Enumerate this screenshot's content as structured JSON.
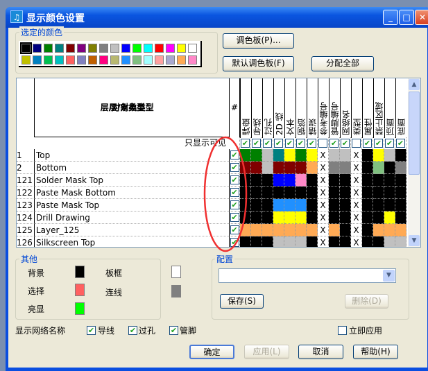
{
  "window": {
    "title": "显示颜色设置",
    "minimize": "_",
    "maximize": "□",
    "close": "✕"
  },
  "palette": {
    "label": "选定的颜色",
    "colors": [
      "#000000",
      "#000080",
      "#008000",
      "#008080",
      "#800000",
      "#800080",
      "#808000",
      "#808080",
      "#c0c0c0",
      "#0000ff",
      "#00ff00",
      "#00ffff",
      "#ff0000",
      "#ff00ff",
      "#ffff00",
      "#ffffff",
      "#c0c000",
      "#0080c0",
      "#00c050",
      "#00c0c0",
      "#ff6060",
      "#8080c0",
      "#c06000",
      "#ff0080",
      "#b8b870",
      "#2090ff",
      "#80c080",
      "#a0ffff",
      "#ffa0a0",
      "#a8a8d0",
      "#ffaa55",
      "#ff88c8"
    ],
    "selected": 0
  },
  "buttons": {
    "palette": "调色板(P)...",
    "default_palette": "默认调色板(F)",
    "assign_all": "分配全部",
    "save": "保存(S)",
    "delete": "删除(D)",
    "ok": "确定",
    "apply": "应用(L)",
    "cancel": "取消",
    "help": "帮助(H)"
  },
  "table": {
    "type_header": "层/对象类型",
    "hash_header": "#",
    "visible_only": "只显示可见",
    "columns": [
      "焊盘",
      "导线",
      "过孔",
      "2D 线",
      "文本",
      "铜箔",
      "错误",
      "参考编号",
      "管脚编号",
      "网络名",
      "类型",
      "属性",
      "禁止区域",
      "顶面",
      "底面"
    ],
    "column_checked": [
      true,
      true,
      true,
      true,
      true,
      true,
      true,
      false,
      true,
      true,
      false,
      true,
      true,
      true,
      true
    ],
    "rows": [
      {
        "num": "1",
        "name": "Top",
        "colors": [
          "#008000",
          "#008000",
          "#c0c0c0",
          "#008080",
          "#ffff00",
          "#008000",
          "#ffff00",
          "X",
          "#c0c0c0",
          "#c0c0c0",
          "X",
          "#000000",
          "#ffff00",
          "#c0c0c0",
          "#000000"
        ]
      },
      {
        "num": "2",
        "name": "Bottom",
        "colors": [
          "#800000",
          "#800000",
          "#c0c0c0",
          "#800000",
          "#800000",
          "#800000",
          "#ffaa55",
          "X",
          "#808080",
          "#808080",
          "X",
          "#000000",
          "#80c080",
          "#000000",
          "#808080"
        ]
      },
      {
        "num": "121",
        "name": "Solder Mask Top",
        "colors": [
          "#000000",
          "#000000",
          "#000000",
          "#0000ff",
          "#0000ff",
          "#ff88c8",
          "#000000",
          "X",
          "#000000",
          "#000000",
          "X",
          "#000000",
          "#000000",
          "#000000",
          "#000000"
        ]
      },
      {
        "num": "122",
        "name": "Paste Mask Bottom",
        "colors": [
          "#000000",
          "#000000",
          "#000000",
          "#000000",
          "#000000",
          "#000000",
          "#000000",
          "X",
          "#000000",
          "#000000",
          "X",
          "#000000",
          "#000000",
          "#000000",
          "#000000"
        ]
      },
      {
        "num": "123",
        "name": "Paste Mask Top",
        "colors": [
          "#000000",
          "#000000",
          "#000000",
          "#2090ff",
          "#2090ff",
          "#2090ff",
          "#000000",
          "X",
          "#000000",
          "#000000",
          "X",
          "#000000",
          "#000000",
          "#000000",
          "#000000"
        ]
      },
      {
        "num": "124",
        "name": "Drill Drawing",
        "colors": [
          "#000000",
          "#000000",
          "#000000",
          "#ffff00",
          "#ffff00",
          "#ffff00",
          "#000000",
          "X",
          "#000000",
          "#000000",
          "X",
          "#000000",
          "#000000",
          "#ffff00",
          "#000000"
        ]
      },
      {
        "num": "125",
        "name": "Layer_125",
        "colors": [
          "#ffaa55",
          "#ffaa55",
          "#ffaa55",
          "#ffaa55",
          "#ffaa55",
          "#ffaa55",
          "#ffaa55",
          "X",
          "#ffaa55",
          "#000000",
          "X",
          "#000000",
          "#ffaa55",
          "#ffaa55",
          "#ffaa55"
        ]
      },
      {
        "num": "126",
        "name": "Silkscreen Top",
        "colors": [
          "#000000",
          "#000000",
          "#000000",
          "#c0c0c0",
          "#c0c0c0",
          "#c0c0c0",
          "#000000",
          "X",
          "#000000",
          "#000000",
          "X",
          "#000000",
          "#000000",
          "#c0c0c0",
          "#c0c0c0"
        ]
      }
    ]
  },
  "other": {
    "label": "其他",
    "background": "背景",
    "board_outline": "板框",
    "selection": "选择",
    "connection": "连线",
    "highlight": "亮显",
    "colors": {
      "background": "#000000",
      "board_outline": "#ffffff",
      "selection": "#ff6060",
      "connection": "#808080",
      "highlight": "#00ff00"
    }
  },
  "config": {
    "label": "配置",
    "value": ""
  },
  "net_names": {
    "label": "显示网络名称",
    "traces": "导线",
    "vias": "过孔",
    "pins": "管脚",
    "traces_checked": true,
    "vias_checked": true,
    "pins_checked": true
  },
  "apply_now": {
    "label": "立即应用",
    "checked": false
  }
}
